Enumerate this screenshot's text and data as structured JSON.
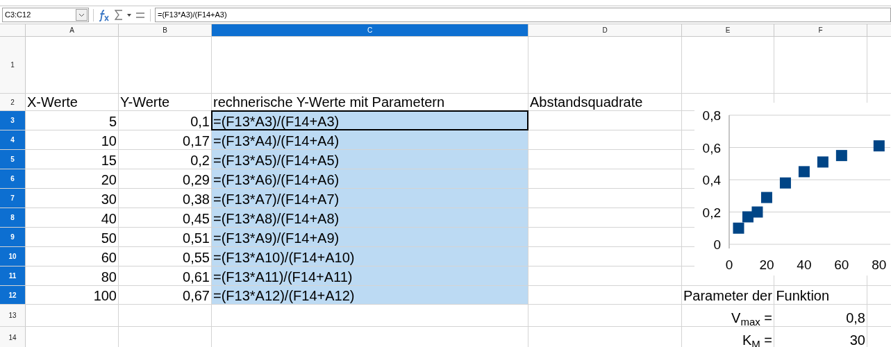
{
  "name_box": "C3:C12",
  "formula": "=(F13*A3)/(F14+A3)",
  "columns": [
    {
      "label": "A",
      "selected": false
    },
    {
      "label": "B",
      "selected": false
    },
    {
      "label": "C",
      "selected": true
    },
    {
      "label": "D",
      "selected": false
    },
    {
      "label": "E",
      "selected": false
    },
    {
      "label": "F",
      "selected": false
    }
  ],
  "rows": [
    {
      "number": "1",
      "selected": false
    },
    {
      "number": "2",
      "selected": false,
      "A": {
        "text": "X-Werte",
        "selected": false,
        "active": false
      },
      "B": {
        "text": "Y-Werte",
        "selected": false,
        "active": false
      },
      "C": {
        "text": "rechnerische Y-Werte mit Parametern",
        "selected": false,
        "active": false
      },
      "D": {
        "text": "Abstandsquadrate",
        "selected": false,
        "active": false
      }
    },
    {
      "number": "3",
      "selected": true,
      "A": {
        "text": "5",
        "kind": "number",
        "selected": false,
        "active": false
      },
      "B": {
        "text": "0,1",
        "kind": "number",
        "selected": false,
        "active": false
      },
      "C": {
        "text": "=(F13*A3)/(F14+A3)",
        "selected": true,
        "active": true
      }
    },
    {
      "number": "4",
      "selected": true,
      "A": {
        "text": "10",
        "kind": "number",
        "selected": false,
        "active": false
      },
      "B": {
        "text": "0,17",
        "kind": "number",
        "selected": false,
        "active": false
      },
      "C": {
        "text": "=(F13*A4)/(F14+A4)",
        "selected": true,
        "active": false
      }
    },
    {
      "number": "5",
      "selected": true,
      "A": {
        "text": "15",
        "kind": "number",
        "selected": false,
        "active": false
      },
      "B": {
        "text": "0,2",
        "kind": "number",
        "selected": false,
        "active": false
      },
      "C": {
        "text": "=(F13*A5)/(F14+A5)",
        "selected": true,
        "active": false
      }
    },
    {
      "number": "6",
      "selected": true,
      "A": {
        "text": "20",
        "kind": "number",
        "selected": false,
        "active": false
      },
      "B": {
        "text": "0,29",
        "kind": "number",
        "selected": false,
        "active": false
      },
      "C": {
        "text": "=(F13*A6)/(F14+A6)",
        "selected": true,
        "active": false
      }
    },
    {
      "number": "7",
      "selected": true,
      "A": {
        "text": "30",
        "kind": "number",
        "selected": false,
        "active": false
      },
      "B": {
        "text": "0,38",
        "kind": "number",
        "selected": false,
        "active": false
      },
      "C": {
        "text": "=(F13*A7)/(F14+A7)",
        "selected": true,
        "active": false
      }
    },
    {
      "number": "8",
      "selected": true,
      "A": {
        "text": "40",
        "kind": "number",
        "selected": false,
        "active": false
      },
      "B": {
        "text": "0,45",
        "kind": "number",
        "selected": false,
        "active": false
      },
      "C": {
        "text": "=(F13*A8)/(F14+A8)",
        "selected": true,
        "active": false
      }
    },
    {
      "number": "9",
      "selected": true,
      "A": {
        "text": "50",
        "kind": "number",
        "selected": false,
        "active": false
      },
      "B": {
        "text": "0,51",
        "kind": "number",
        "selected": false,
        "active": false
      },
      "C": {
        "text": "=(F13*A9)/(F14+A9)",
        "selected": true,
        "active": false
      }
    },
    {
      "number": "10",
      "selected": true,
      "A": {
        "text": "60",
        "kind": "number",
        "selected": false,
        "active": false
      },
      "B": {
        "text": "0,55",
        "kind": "number",
        "selected": false,
        "active": false
      },
      "C": {
        "text": "=(F13*A10)/(F14+A10)",
        "selected": true,
        "active": false
      }
    },
    {
      "number": "11",
      "selected": true,
      "A": {
        "text": "80",
        "kind": "number",
        "selected": false,
        "active": false
      },
      "B": {
        "text": "0,61",
        "kind": "number",
        "selected": false,
        "active": false
      },
      "C": {
        "text": "=(F13*A11)/(F14+A11)",
        "selected": true,
        "active": false
      }
    },
    {
      "number": "12",
      "selected": true,
      "A": {
        "text": "100",
        "kind": "number",
        "selected": false,
        "active": false
      },
      "B": {
        "text": "0,67",
        "kind": "number",
        "selected": false,
        "active": false
      },
      "C": {
        "text": "=(F13*A12)/(F14+A12)",
        "selected": true,
        "active": false
      },
      "E": {
        "text": "Parameter der Funktion",
        "selected": false,
        "active": false
      }
    },
    {
      "number": "13",
      "selected": false,
      "E": {
        "text": "V$_{max}$ =",
        "kind": "number",
        "selected": false,
        "active": false
      },
      "F": {
        "text": "0,8",
        "kind": "number",
        "selected": false,
        "active": false
      }
    },
    {
      "number": "14",
      "selected": false,
      "E": {
        "text": "K$_{M}$ =",
        "kind": "number",
        "selected": false,
        "active": false
      },
      "F": {
        "text": "30",
        "kind": "number",
        "selected": false,
        "active": false
      }
    }
  ],
  "chart": {
    "chart_data": {
      "type": "scatter",
      "x": [
        5,
        10,
        15,
        20,
        30,
        40,
        50,
        60,
        80
      ],
      "series": [
        {
          "color": "#004586",
          "values": [
            0.1,
            0.17,
            0.2,
            0.29,
            0.38,
            0.45,
            0.51,
            0.55,
            0.61
          ]
        }
      ],
      "xlim": [
        0,
        86
      ],
      "ylim": [
        0,
        0.8
      ],
      "grid": true,
      "xticks": [
        0,
        20,
        40,
        60,
        80
      ],
      "yticks": [
        {
          "value": 0,
          "label": "0"
        },
        {
          "value": 0.2,
          "label": "0,2"
        },
        {
          "value": 0.4,
          "label": "0,4"
        },
        {
          "value": 0.6,
          "label": "0,6"
        },
        {
          "value": 0.8,
          "label": "0,8"
        }
      ]
    }
  }
}
